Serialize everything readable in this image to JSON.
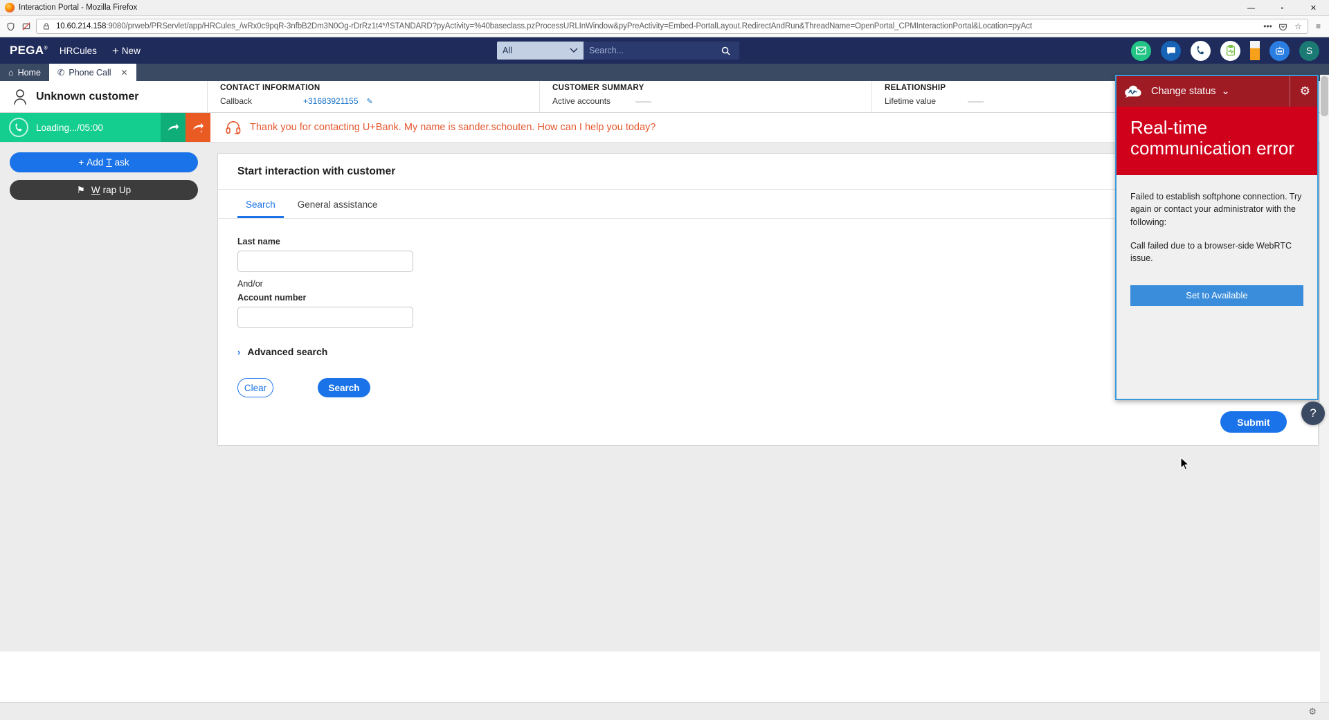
{
  "browser": {
    "window_title": "Interaction Portal - Mozilla Firefox",
    "minimize": "—",
    "maximize": "▫",
    "close": "✕",
    "url_host": "10.60.214.158",
    "url_rest": ":9080/prweb/PRServlet/app/HRCules_/wRx0c9pqR-3nfbB2Dm3N0Og-rDrRz1t4*/!STANDARD?pyActivity=%40baseclass.pzProcessURLInWindow&pyPreActivity=Embed-PortalLayout.RedirectAndRun&ThreadName=OpenPortal_CPMInteractionPortal&Location=pyAct",
    "icons": {
      "shield": "shield-icon",
      "permissions": "permissions-blocked-icon",
      "reader": "reader-view-icon",
      "more": "•••",
      "save_to_pocket": "pocket-icon",
      "bookmark": "☆",
      "menu": "≡"
    }
  },
  "header": {
    "logo": "PEGA",
    "logo_mark": "®",
    "app_name": "HRCules",
    "new_label": "New",
    "new_plus": "+",
    "search": {
      "category": "All",
      "placeholder": "Search...",
      "value": ""
    },
    "icons": [
      {
        "name": "email-icon",
        "glyph": "✉",
        "bg": "#22c585",
        "fg": "#ffffff"
      },
      {
        "name": "chat-icon",
        "glyph": "▤",
        "bg": "#1763b5",
        "fg": "#ffffff"
      },
      {
        "name": "phone-icon",
        "glyph": "✆",
        "bg": "#ffffff",
        "fg": "#1b4f7a"
      },
      {
        "name": "tasks-clipboard-icon",
        "glyph": "▤",
        "bg": "#ffffff",
        "fg": "#7ac143"
      },
      {
        "name": "status-bar-icon",
        "glyph": "",
        "bg": "#f7a01b",
        "fg": "#ffffff"
      },
      {
        "name": "assistant-bot-icon",
        "glyph": "☻",
        "bg": "#2a7de1",
        "fg": "#ffffff"
      },
      {
        "name": "user-avatar",
        "glyph": "S",
        "bg": "#1b7a74",
        "fg": "#ffffff"
      }
    ]
  },
  "tabs": [
    {
      "label": "Home",
      "icon": "⌂",
      "active": false,
      "closable": false
    },
    {
      "label": "Phone Call",
      "icon": "✆",
      "active": true,
      "closable": true,
      "close_glyph": "✕"
    }
  ],
  "customer_banner": {
    "avatar_icon": "person-icon",
    "name": "Unknown customer",
    "columns": [
      {
        "title": "CONTACT INFORMATION",
        "rows": [
          {
            "label": "Callback",
            "value": "+31683921155",
            "is_link": true,
            "edit_icon": "✎"
          }
        ]
      },
      {
        "title": "CUSTOMER SUMMARY",
        "rows": [
          {
            "label": "Active accounts",
            "value": "——",
            "is_link": false
          }
        ]
      },
      {
        "title": "RELATIONSHIP",
        "rows": [
          {
            "label": "Lifetime value",
            "value": "——",
            "is_link": false
          }
        ]
      }
    ]
  },
  "interaction_strip": {
    "call_icon": "phone-icon",
    "timer": "Loading.../05:00",
    "transfer_icon": "➔",
    "transfer_cancel_icon": "➔",
    "headset_icon": "headset-icon",
    "greeting": "Thank you for contacting U+Bank. My name is sander.schouten. How can I help you today?"
  },
  "left_rail": {
    "add_task": {
      "prefix": "+",
      "label_before": "Add ",
      "accel": "T",
      "label_after": "ask"
    },
    "wrap_up": {
      "icon": "⚑",
      "accel": "W",
      "label_after": "rap Up"
    }
  },
  "work": {
    "title": "Start interaction with customer",
    "tabs": [
      {
        "label": "Search",
        "active": true
      },
      {
        "label": "General assistance",
        "active": false
      }
    ],
    "fields": [
      {
        "label": "Last name",
        "value": "",
        "placeholder": ""
      },
      {
        "label": "Account number",
        "value": "",
        "placeholder": ""
      }
    ],
    "andor": "And/or",
    "advanced_search": {
      "chevron": "›",
      "label": "Advanced search"
    },
    "buttons": {
      "clear": "Clear",
      "search": "Search",
      "submit": "Submit"
    }
  },
  "notification": {
    "cloud_icon": "pulse-cloud-icon",
    "status_label": "Change status",
    "status_chevron": "⌄",
    "gear_icon": "⚙",
    "error_title": "Real-time communication error",
    "body_paragraph_1": "Failed to establish softphone connection. Try again or contact your administrator with the following:",
    "body_paragraph_2": "Call failed due to a browser-side WebRTC issue.",
    "action_button": "Set to Available",
    "colors": {
      "header": "#9e1b24",
      "banner": "#d0021b",
      "button": "#3a8ddb",
      "border": "#3a9ad9"
    }
  },
  "misc": {
    "help_fab": "?",
    "bottom_gear": "⚙"
  },
  "theme": {
    "pega_navy": "#1f2b5b",
    "tab_strip": "#3b4a63",
    "accent_blue": "#1a73e8",
    "call_green": "#13ce8f",
    "greeting_orange": "#e4572e"
  }
}
